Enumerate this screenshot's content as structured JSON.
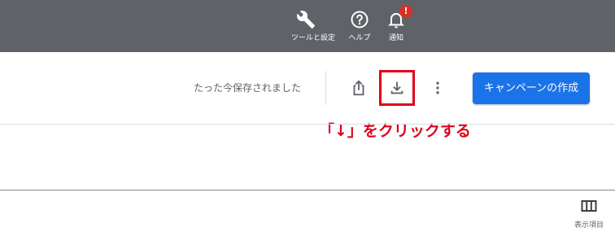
{
  "header": {
    "tools_label": "ツールと設定",
    "help_label": "ヘルプ",
    "notifications_label": "通知",
    "notification_badge": "!"
  },
  "toolbar": {
    "saved_status": "たった今保存されました",
    "share_icon": "share-icon",
    "download_icon": "download-icon",
    "more_icon": "more-vert-icon",
    "create_campaign_label": "キャンペーンの作成"
  },
  "annotation": {
    "text": "「↓」をクリックする"
  },
  "table": {
    "columns_label": "表示項目"
  },
  "colors": {
    "header_bg": "#5f6368",
    "primary_button": "#1a73e8",
    "annotation_red": "#e0001a",
    "badge_red": "#d93025"
  }
}
